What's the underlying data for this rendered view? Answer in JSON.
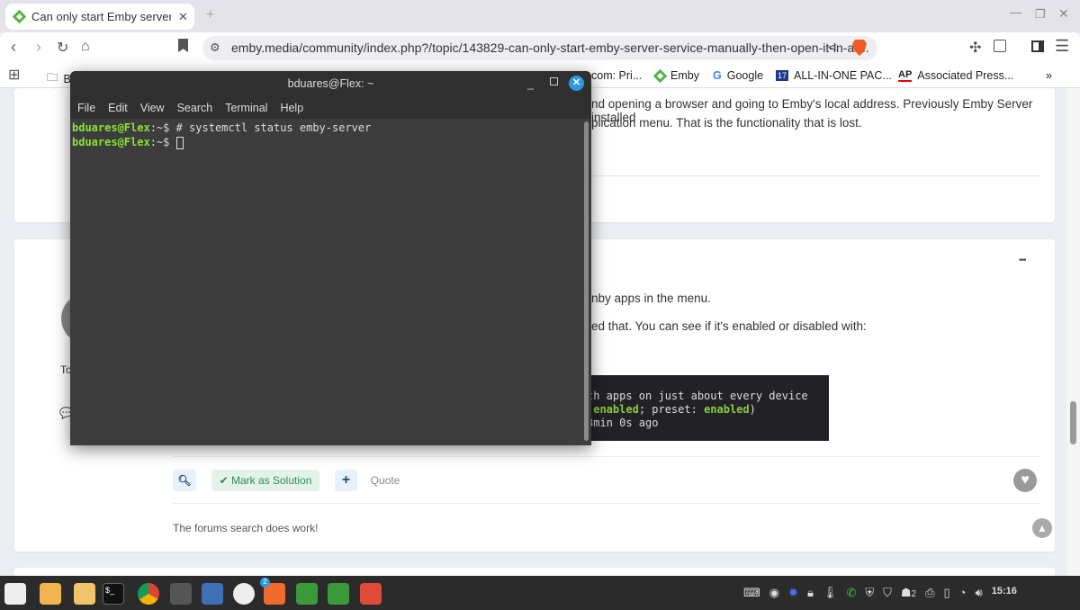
{
  "browser": {
    "tab_title": "Can only start Emby server se",
    "url": "emby.media/community/index.php?/topic/143829-can-only-start-emby-server-service-manually-then-open-it-in-a-...",
    "bookmarks": [
      {
        "label": "B"
      },
      {
        "label": "com: Pri..."
      },
      {
        "label": "Emby"
      },
      {
        "label": "Google"
      },
      {
        "label": "ALL-IN-ONE PAC..."
      },
      {
        "label": "Associated Press..."
      }
    ],
    "more": "»"
  },
  "post1": {
    "line1": "nd opening a browser and going to Emby's local address. Previously Emby Server installed",
    "line2": "plication menu. That is the functionality that is lost."
  },
  "post2": {
    "author_fragment": "To",
    "line1": "nby apps in the menu.",
    "line2": "ed that. You can see if it's enabled or disabled with:",
    "code": {
      "l1": "th apps on just about every device",
      "l2_a": " ",
      "l2_b": "enabled",
      "l2_c": "; preset: ",
      "l2_d": "enabled",
      "l2_e": ")",
      "l3": "3min 0s ago"
    },
    "more_menu": "•••",
    "mark_solution": "✔ Mark as Solution",
    "quote": "Quote",
    "signature": "The forums search does work!"
  },
  "terminal": {
    "title": "bduares@Flex: ~",
    "menu": [
      "File",
      "Edit",
      "View",
      "Search",
      "Terminal",
      "Help"
    ],
    "prompt": "bduares@Flex",
    "path": ":~$ ",
    "command": "# systemctl status emby-server"
  },
  "taskbar": {
    "brave_badge": "2",
    "notifications": "2",
    "clock": "15:16"
  }
}
